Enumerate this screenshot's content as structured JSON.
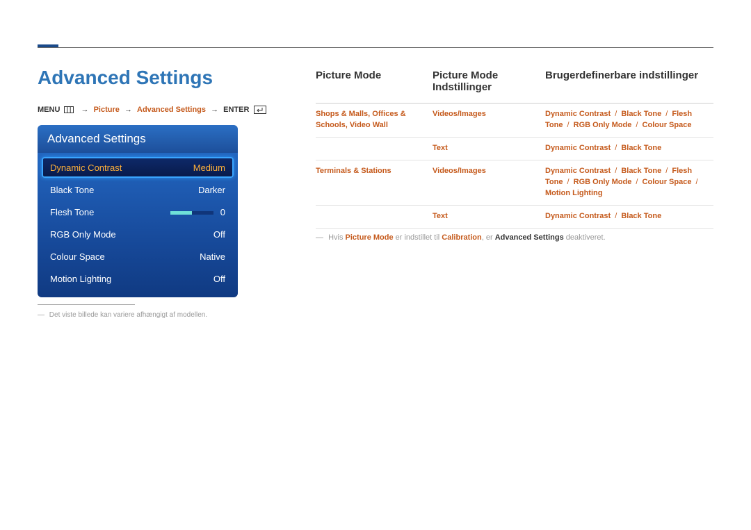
{
  "heading": "Advanced Settings",
  "breadcrumb": {
    "menu_label": "MENU",
    "picture": "Picture",
    "advanced": "Advanced Settings",
    "enter_label": "ENTER"
  },
  "osd": {
    "title": "Advanced Settings",
    "rows": [
      {
        "label": "Dynamic Contrast",
        "value": "Medium",
        "selected": true
      },
      {
        "label": "Black Tone",
        "value": "Darker"
      },
      {
        "label": "Flesh Tone",
        "value": "0",
        "slider": true
      },
      {
        "label": "RGB Only Mode",
        "value": "Off"
      },
      {
        "label": "Colour Space",
        "value": "Native"
      },
      {
        "label": "Motion Lighting",
        "value": "Off"
      }
    ]
  },
  "footnote": "Det viste billede kan variere afhængigt af modellen.",
  "table": {
    "headers": {
      "col1": "Picture Mode",
      "col2": "Picture Mode Indstillinger",
      "col3": "Brugerdefinerbare indstillinger"
    },
    "rows": [
      {
        "c1": "Shops & Malls, Offices & Schools, Video Wall",
        "c2": "Videos/Images",
        "c3": [
          "Dynamic Contrast",
          "Black Tone",
          "Flesh Tone",
          "RGB Only Mode",
          "Colour Space"
        ]
      },
      {
        "c1": "",
        "c2": "Text",
        "c3": [
          "Dynamic Contrast",
          "Black Tone"
        ]
      },
      {
        "c1": "Terminals & Stations",
        "c2": "Videos/Images",
        "c3": [
          "Dynamic Contrast",
          "Black Tone",
          "Flesh Tone",
          "RGB Only Mode",
          "Colour Space",
          "Motion Lighting"
        ]
      },
      {
        "c1": "",
        "c2": "Text",
        "c3": [
          "Dynamic Contrast",
          "Black Tone"
        ]
      }
    ],
    "note": {
      "prefix": "Hvis ",
      "pm": "Picture Mode",
      "mid": " er indstillet til ",
      "cal": "Calibration",
      "mid2": ", er ",
      "as": "Advanced Settings",
      "suffix": " deaktiveret."
    }
  }
}
